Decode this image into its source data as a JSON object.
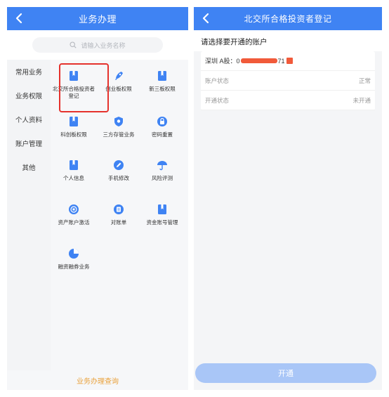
{
  "left": {
    "title": "业务办理",
    "search_placeholder": "请输入业务名称",
    "sidebar": [
      "常用业务",
      "业务权限",
      "个人资料",
      "账户管理",
      "其他"
    ],
    "services": [
      {
        "label": "北交所合格投资者登记",
        "icon": "book-icon"
      },
      {
        "label": "创业板权限",
        "icon": "rocket-icon"
      },
      {
        "label": "新三板权限",
        "icon": "book-icon"
      },
      {
        "label": "科创板权限",
        "icon": "book-icon"
      },
      {
        "label": "三方存管业务",
        "icon": "shield-icon"
      },
      {
        "label": "密码重置",
        "icon": "lock-icon"
      },
      {
        "label": "个人信息",
        "icon": "book-icon"
      },
      {
        "label": "手机修改",
        "icon": "edit-icon"
      },
      {
        "label": "风险评测",
        "icon": "umbrella-icon"
      },
      {
        "label": "资产账户激活",
        "icon": "coin-icon"
      },
      {
        "label": "对账单",
        "icon": "document-icon"
      },
      {
        "label": "资金账号管理",
        "icon": "book-icon"
      },
      {
        "label": "融资融券业务",
        "icon": "pie-chart-icon"
      }
    ],
    "bottom_link": "业务办理查询"
  },
  "right": {
    "title": "北交所合格投资者登记",
    "section_title": "请选择要开通的账户",
    "account_prefix": "深圳 A股：",
    "account_visible_start": "0",
    "account_visible_end": "71",
    "status_label": "账户状态",
    "status_value": "正常",
    "open_status_label": "开通状态",
    "open_status_value": "未开通",
    "open_button": "开通"
  },
  "colors": {
    "primary": "#3f83f3",
    "highlight": "#e5322d",
    "accent": "#e9a13b",
    "button_disabled": "#a9c6f7"
  }
}
